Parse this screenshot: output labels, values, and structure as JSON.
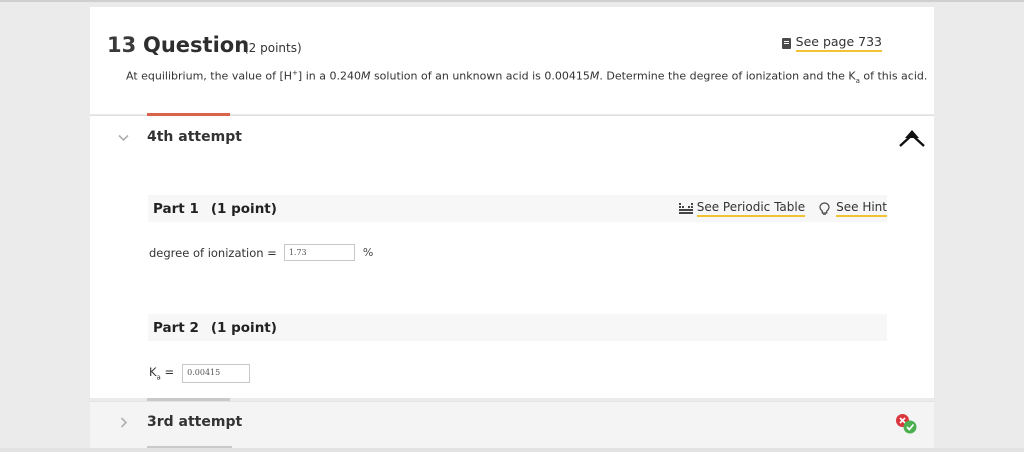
{
  "question": {
    "number": "13",
    "title": "Question",
    "points": "(2 points)",
    "see_page": "See page 733",
    "text_before_h": "At equilibrium, the value of [H",
    "text_sup": "+",
    "text_mid": "] in a 0.240",
    "text_M1": "M",
    "text_mid2": " solution of an unknown acid is 0.00415",
    "text_M2": "M",
    "text_mid3": ". Determine the degree of ionization and the K",
    "text_sub": "a",
    "text_end": " of this acid."
  },
  "attempt_current": {
    "label": "4th attempt"
  },
  "part1": {
    "title": "Part 1",
    "points": "(1 point)",
    "see_periodic_table": "See Periodic Table",
    "see_hint": "See Hint",
    "field_label": "degree of ionization =",
    "field_value": "1.73",
    "unit": "%"
  },
  "part2": {
    "title": "Part 2",
    "points": "(1 point)",
    "field_label_main": "K",
    "field_label_sub": "a",
    "field_label_eq": " =",
    "field_value": "0.00415"
  },
  "attempt_previous": {
    "label": "3rd attempt"
  },
  "icons": {
    "book": "book-icon",
    "periodic": "periodic-table-icon",
    "hint": "lightbulb-icon",
    "collapse": "arrow-up-icon",
    "status": "incorrect-correct-status-icon"
  },
  "colors": {
    "accent": "#d9634b",
    "link_underline": "#f1c232",
    "incorrect": "#d9363e",
    "correct": "#4caf50"
  }
}
